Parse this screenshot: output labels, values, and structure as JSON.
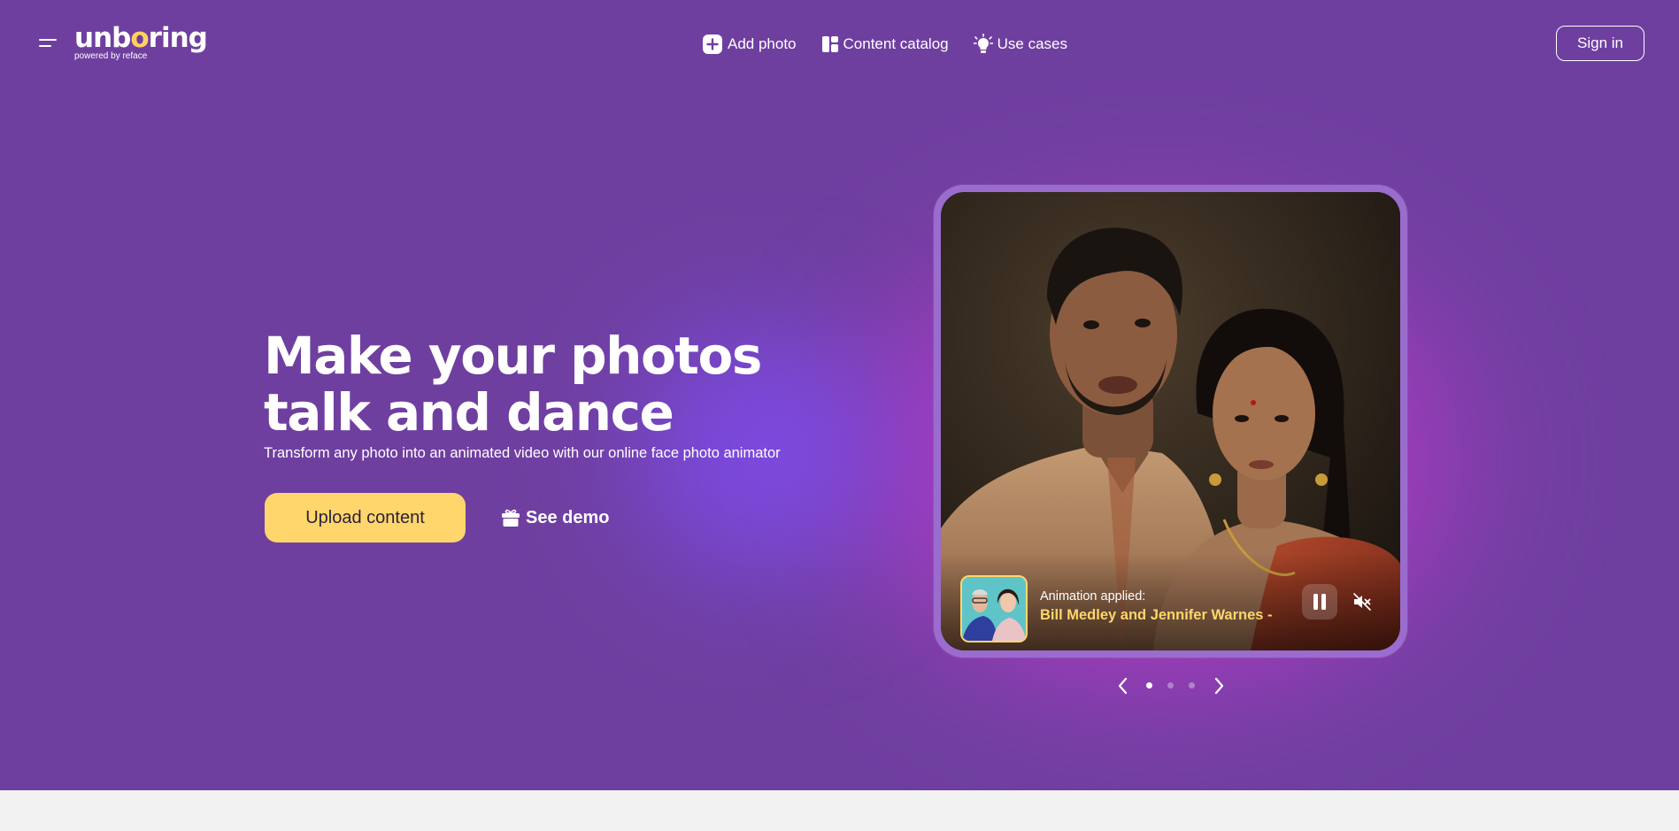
{
  "brand": {
    "name_pre": "unb",
    "name_o": "o",
    "name_post": "ring",
    "tagline": "powered by reface"
  },
  "nav": [
    {
      "label": "Add photo",
      "icon": "plus-square-icon"
    },
    {
      "label": "Content catalog",
      "icon": "catalog-icon"
    },
    {
      "label": "Use cases",
      "icon": "lightbulb-icon"
    }
  ],
  "header": {
    "signin_label": "Sign in"
  },
  "hero": {
    "headline_line1": "Make your photos",
    "headline_line2": "talk and dance",
    "subhead": "Transform any photo into an animated video with our online face photo animator",
    "upload_label": "Upload content",
    "demo_label": "See demo"
  },
  "card": {
    "animation_label": "Animation applied:",
    "animation_title": "Bill Medley and Jennifer Warnes -",
    "carousel_active_index": 0,
    "carousel_count": 3
  },
  "colors": {
    "background": "#6f3fa0",
    "accent_yellow": "#ffd66b",
    "footer_band": "#f2f2f2"
  }
}
